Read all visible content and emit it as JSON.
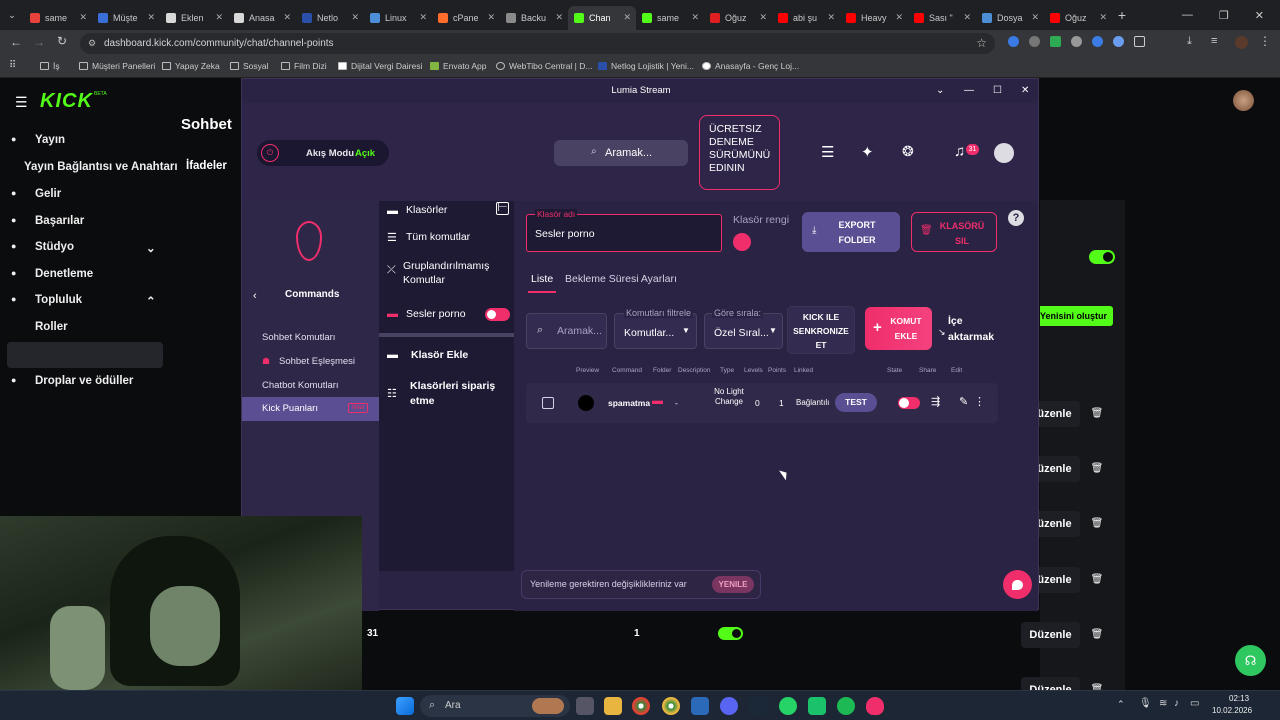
{
  "browser": {
    "tabs": [
      {
        "label": "same",
        "color": "#e8423b"
      },
      {
        "label": "Müşte",
        "color": "#3b6fd8"
      },
      {
        "label": "Eklen",
        "color": "#d8d8d8"
      },
      {
        "label": "Anasa",
        "color": "#d8d8d8"
      },
      {
        "label": "Netlo",
        "color": "#2a4fa8"
      },
      {
        "label": "Linux",
        "color": "#4d8fd6"
      },
      {
        "label": "cPane",
        "color": "#ff6c2c"
      },
      {
        "label": "Backu",
        "color": "#8a8a8a"
      },
      {
        "label": "Chan",
        "color": "#53fc18"
      },
      {
        "label": "same",
        "color": "#53fc18"
      },
      {
        "label": "Oğuz",
        "color": "#e02020"
      },
      {
        "label": "abi şu",
        "color": "#ff0000"
      },
      {
        "label": "Heavy",
        "color": "#ff0000"
      },
      {
        "label": "Sası \"",
        "color": "#ff0000"
      },
      {
        "label": "Dosya",
        "color": "#4d8fd6"
      },
      {
        "label": "Oğuz",
        "color": "#ff0000"
      }
    ],
    "active_tab": 8,
    "url": "dashboard.kick.com/community/chat/channel-points",
    "bookmarks": [
      "İş",
      "Müşteri Panelleri",
      "Yapay Zeka",
      "Sosyal",
      "Film Dizi",
      "Dijital Vergi Dairesi",
      "Envato App",
      "WebTibo Central | D...",
      "Netlog Lojistik | Yeni...",
      "Anasayfa - Genç Loj..."
    ]
  },
  "kick": {
    "logo": "KICK",
    "logo_badge": "BETA",
    "sidebar": [
      {
        "label": "Yayın",
        "icon": "broadcast-icon"
      },
      {
        "label": "Yayın Bağlantısı ve Anahtarı",
        "icon": ""
      },
      {
        "label": "Gelir",
        "icon": "revenue-icon"
      },
      {
        "label": "Başarılar",
        "icon": "trophy-icon"
      },
      {
        "label": "Stüdyo",
        "icon": "studio-icon"
      },
      {
        "label": "Denetleme",
        "icon": "wrench-icon"
      },
      {
        "label": "Topluluk",
        "icon": "community-icon"
      },
      {
        "label": "Roller",
        "icon": ""
      },
      {
        "label": "Sohbet",
        "icon": ""
      },
      {
        "label": "Droplar ve ödüller",
        "icon": "drops-icon"
      }
    ],
    "page_title": "Sohbet",
    "subtab": "İfadeler",
    "create_new": "Yenisini oluştur",
    "row_number": "31",
    "row_value": "1",
    "edit_label": "Düzenle"
  },
  "lumia": {
    "window_title": "Lumia Stream",
    "stream_mode_label": "Akış Modu",
    "stream_mode_state": "Açık",
    "search_label": "Aramak...",
    "trial_text": "ÜCRETSIZ DENEME SÜRÜMÜNÜ EDININ",
    "notif_count": "31",
    "nav_title": "Commands",
    "nav_items": [
      "Sohbet Komutları",
      "Sohbet Eşleşmesi",
      "Chatbot Komutları",
      "Kick Puanları"
    ],
    "nav_new_badge": "New",
    "folders_header": "Klasörler",
    "folder_items": [
      "Tüm komutlar",
      "Gruplandırılmamış Komutlar",
      "Sesler porno"
    ],
    "add_folder": "Klasör Ekle",
    "sort_folders": "Klasörleri sipariş etme",
    "folder_name_label": "Klasör adı",
    "folder_name_value": "Sesler porno",
    "folder_color_label": "Klasör rengi",
    "folder_color": "#ef2e6b",
    "export_folder": "EXPORT FOLDER",
    "delete_folder": "KLASÖRÜ SIL",
    "tab_list": "Liste",
    "tab_cooldown": "Bekleme Süresi Ayarları",
    "filter_search": "Aramak...",
    "filter_label": "Komutları filtrele",
    "filter_value": "Komutlar...",
    "sort_label": "Göre sırala:",
    "sort_value": "Özel Sıral...",
    "sync_kick": "KICK ILE SENKRONIZE ET",
    "add_command": "KOMUT EKLE",
    "import": "İçe aktarmak",
    "columns": [
      "Preview",
      "Command",
      "Folder",
      "Description",
      "Type",
      "Levels",
      "Points",
      "Linked",
      "State",
      "Share",
      "Edit"
    ],
    "row": {
      "command": "spamatma",
      "description": "-",
      "type": "No Light Change",
      "levels": "0",
      "points": "1",
      "linked": "Bağlantılı",
      "test": "TEST"
    },
    "pending_changes": "Yenileme gerektiren değişiklikleriniz var",
    "refresh": "YENILE"
  },
  "taskbar": {
    "search": "Ara",
    "time": "02:13",
    "date": "10.02.2026"
  }
}
